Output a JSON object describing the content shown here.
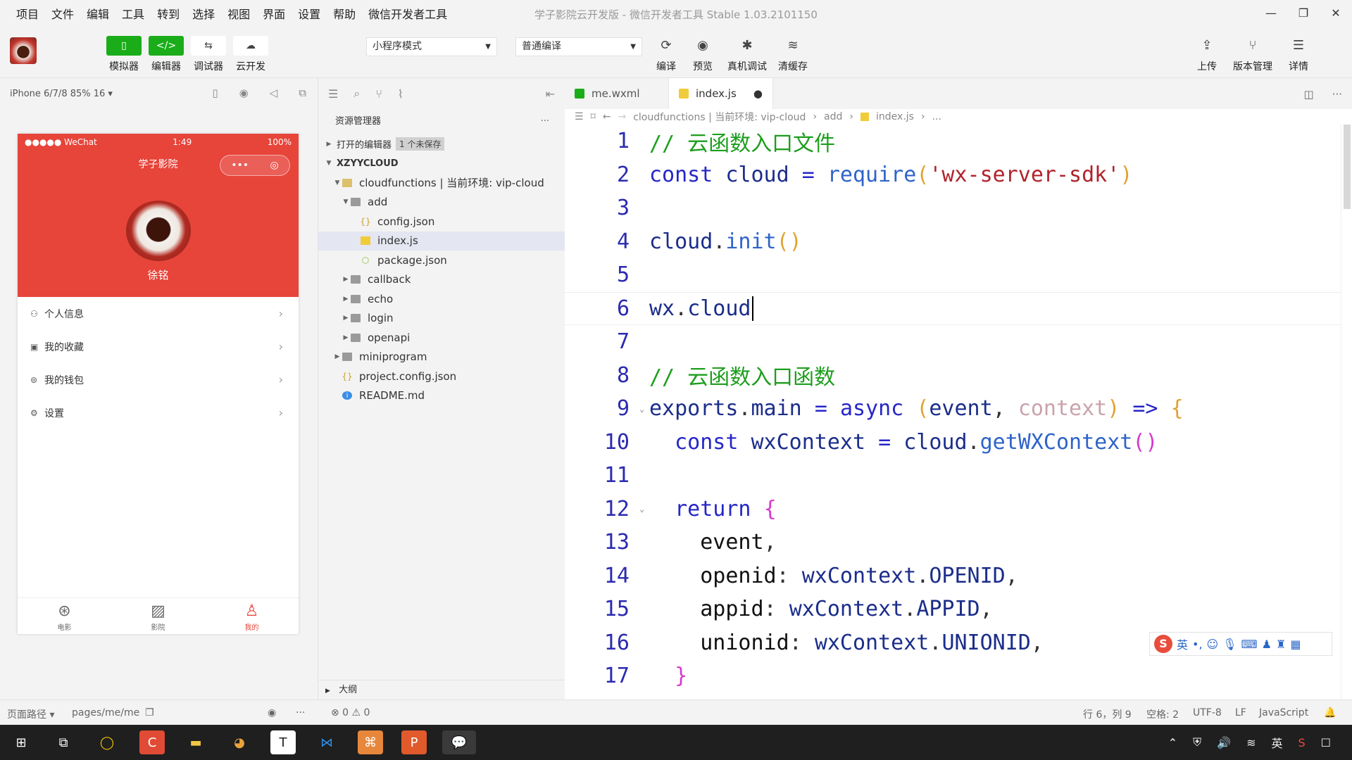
{
  "menubar": {
    "items": [
      "项目",
      "文件",
      "编辑",
      "工具",
      "转到",
      "选择",
      "视图",
      "界面",
      "设置",
      "帮助",
      "微信开发者工具"
    ],
    "title": "学子影院云开发版 - 微信开发者工具 Stable 1.03.2101150"
  },
  "toolbar": {
    "simulator": "模拟器",
    "editor": "编辑器",
    "debugger": "调试器",
    "cloud": "云开发",
    "mode_select": "小程序模式",
    "compile_select": "普通编译",
    "compile": "编译",
    "preview": "预览",
    "device_debug": "真机调试",
    "clear_cache": "清缓存",
    "upload": "上传",
    "version": "版本管理",
    "details": "详情"
  },
  "simulator": {
    "device": "iPhone 6/7/8 85% 16 ▾",
    "status_carrier": "●●●●● WeChat",
    "status_time": "1:49",
    "status_battery": "100%",
    "nav_title": "学子影院",
    "user_name": "徐铭",
    "menu": [
      {
        "icon": "person-icon",
        "label": "个人信息"
      },
      {
        "icon": "favorites-icon",
        "label": "我的收藏"
      },
      {
        "icon": "wallet-icon",
        "label": "我的钱包"
      },
      {
        "icon": "settings-icon",
        "label": "设置"
      }
    ],
    "tabs": [
      {
        "icon": "film-reel-icon",
        "label": "电影",
        "active": false
      },
      {
        "icon": "cinema-icon",
        "label": "影院",
        "active": false
      },
      {
        "icon": "profile-icon",
        "label": "我的",
        "active": true
      }
    ]
  },
  "explorer": {
    "title": "资源管理器",
    "open_editors": "打开的编辑器",
    "unsaved_badge": "1 个未保存",
    "project": "XZYYCLOUD",
    "nodes": [
      {
        "label": "cloudfunctions | 当前环境: vip-cloud",
        "depth": 1,
        "type": "folder-open"
      },
      {
        "label": "add",
        "depth": 2,
        "type": "folder-open"
      },
      {
        "label": "config.json",
        "depth": 3,
        "type": "json"
      },
      {
        "label": "index.js",
        "depth": 3,
        "type": "js"
      },
      {
        "label": "package.json",
        "depth": 3,
        "type": "pkg"
      },
      {
        "label": "callback",
        "depth": 2,
        "type": "folder"
      },
      {
        "label": "echo",
        "depth": 2,
        "type": "folder"
      },
      {
        "label": "login",
        "depth": 2,
        "type": "folder"
      },
      {
        "label": "openapi",
        "depth": 2,
        "type": "folder"
      },
      {
        "label": "miniprogram",
        "depth": 1,
        "type": "folder"
      },
      {
        "label": "project.config.json",
        "depth": 1,
        "type": "json"
      },
      {
        "label": "README.md",
        "depth": 1,
        "type": "info"
      }
    ],
    "outline": "大纲"
  },
  "tabs": [
    {
      "label": "me.wxml",
      "active": false
    },
    {
      "label": "index.js",
      "active": true
    }
  ],
  "breadcrumb": {
    "path1": "cloudfunctions | 当前环境: vip-cloud",
    "path2": "add",
    "path3": "index.js",
    "more": "..."
  },
  "code": {
    "line_numbers": [
      "1",
      "2",
      "3",
      "4",
      "5",
      "6",
      "7",
      "8",
      "9",
      "10",
      "11",
      "12",
      "13",
      "14",
      "15",
      "16",
      "17"
    ]
  },
  "ime": {
    "lang": "英"
  },
  "status": {
    "page_path_label": "页面路径 ▾",
    "page_path": "pages/me/me",
    "problems": "⊗ 0 ⚠ 0",
    "position": "行 6，列 9",
    "spaces": "空格: 2",
    "encoding": "UTF-8",
    "eol": "LF",
    "language": "JavaScript"
  },
  "tray": {
    "lang": "英"
  },
  "colors": {
    "accent_green": "#1aad19",
    "phone_header": "#e7443a"
  }
}
